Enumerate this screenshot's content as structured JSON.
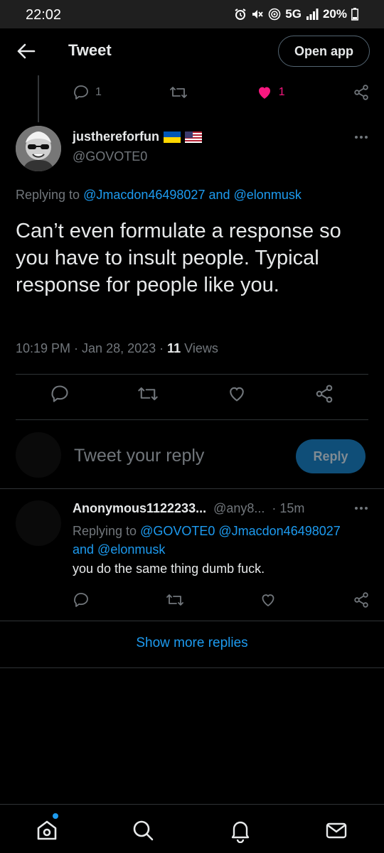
{
  "status_bar": {
    "time": "22:02",
    "network": "5G",
    "battery": "20%"
  },
  "header": {
    "title": "Tweet",
    "open_app_label": "Open app"
  },
  "previous_tweet_actions": {
    "reply_count": "1",
    "like_count": "1"
  },
  "tweet": {
    "author_name": "justhereforfun",
    "flags": [
      "ukraine-flag-icon",
      "us-flag-icon"
    ],
    "author_handle": "@GOVOTE0",
    "replying_prefix": "Replying to ",
    "replying_user1": "@Jmacdon46498027",
    "replying_and": " and ",
    "replying_user2": "@elonmusk",
    "text": "Can’t even formulate a response so you have to insult people. Typical response for people like you.",
    "time_date": "10:19 PM · Jan 28, 2023 · ",
    "views_count": "11",
    "views_label": " Views"
  },
  "compose": {
    "placeholder": "Tweet your reply",
    "reply_button": "Reply"
  },
  "reply": {
    "name": "Anonymous1122233...",
    "handle": "@any8...",
    "age": "· 15m",
    "replying_prefix": "Replying to ",
    "user1": "@GOVOTE0",
    "user2": "@Jmacdon46498027",
    "and": "and ",
    "user3": "@elonmusk",
    "text": "you do the same thing dumb fuck."
  },
  "show_more_label": "Show more replies",
  "colors": {
    "background": "#000000",
    "text": "#e7e9ea",
    "muted": "#71767b",
    "accent": "#1d9bf0",
    "like": "#f91880"
  }
}
